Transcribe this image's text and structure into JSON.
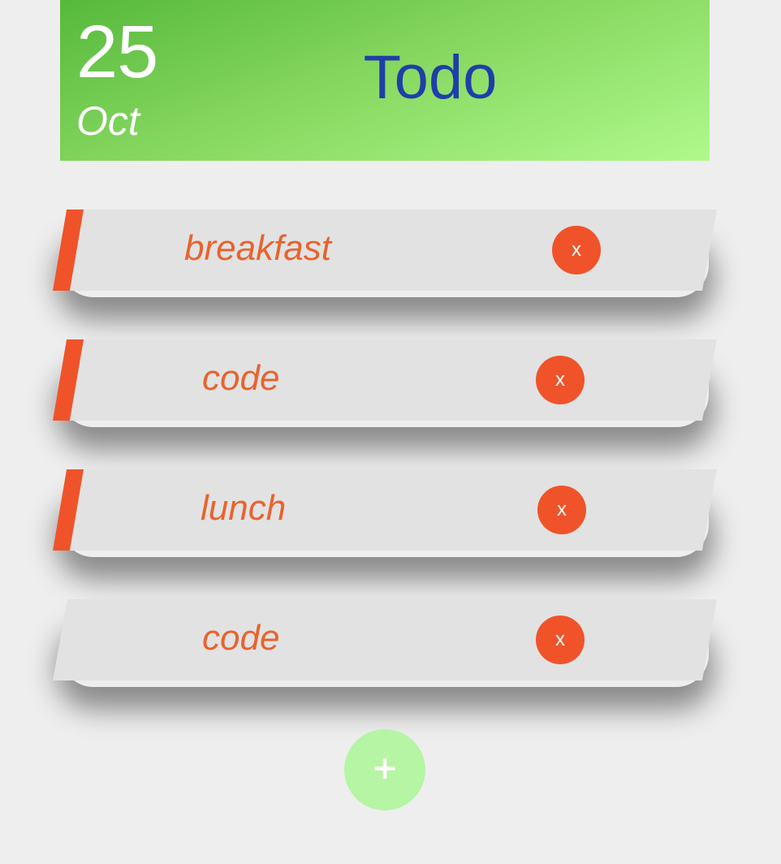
{
  "header": {
    "day": "25",
    "month": "Oct",
    "title": "Todo"
  },
  "todos": [
    {
      "label": "breakfast",
      "delete_label": "x",
      "accent": true
    },
    {
      "label": "code",
      "delete_label": "x",
      "accent": true
    },
    {
      "label": "lunch",
      "delete_label": "x",
      "accent": true
    },
    {
      "label": "code",
      "delete_label": "x",
      "accent": false
    }
  ],
  "add_button": {
    "label": "+"
  },
  "colors": {
    "header_gradient_start": "#56b93c",
    "header_gradient_end": "#b0f98c",
    "title": "#1e3fa8",
    "accent": "#f0532a",
    "item_text": "#e8632e",
    "item_background": "#e2e2e2",
    "add_button": "#b5f5a3",
    "page_background": "#eeeeee"
  }
}
